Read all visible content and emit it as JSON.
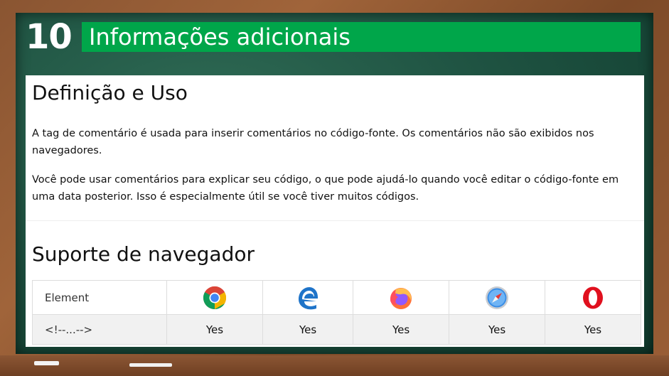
{
  "slide": {
    "number": "10",
    "title": "Informações adicionais"
  },
  "content": {
    "definition_heading": "Definição e Uso",
    "paragraph1": "A tag de comentário é usada para inserir comentários no código-fonte. Os comentários não são exibidos nos navegadores.",
    "paragraph2": "Você pode usar comentários para explicar seu código, o que pode ajudá-lo quando você editar o código-fonte em uma data posterior. Isso é especialmente útil se você tiver muitos códigos.",
    "support_heading": "Suporte de navegador"
  },
  "support_table": {
    "header_first": "Element",
    "browsers": [
      {
        "icon": "chrome-icon"
      },
      {
        "icon": "edge-icon"
      },
      {
        "icon": "firefox-icon"
      },
      {
        "icon": "safari-icon"
      },
      {
        "icon": "opera-icon"
      }
    ],
    "row": {
      "element": "<!--...-->",
      "values": [
        "Yes",
        "Yes",
        "Yes",
        "Yes",
        "Yes"
      ]
    }
  },
  "colors": {
    "title_bar": "#00a64a",
    "chalkboard": "#1f5342",
    "frame": "#8a5532"
  }
}
